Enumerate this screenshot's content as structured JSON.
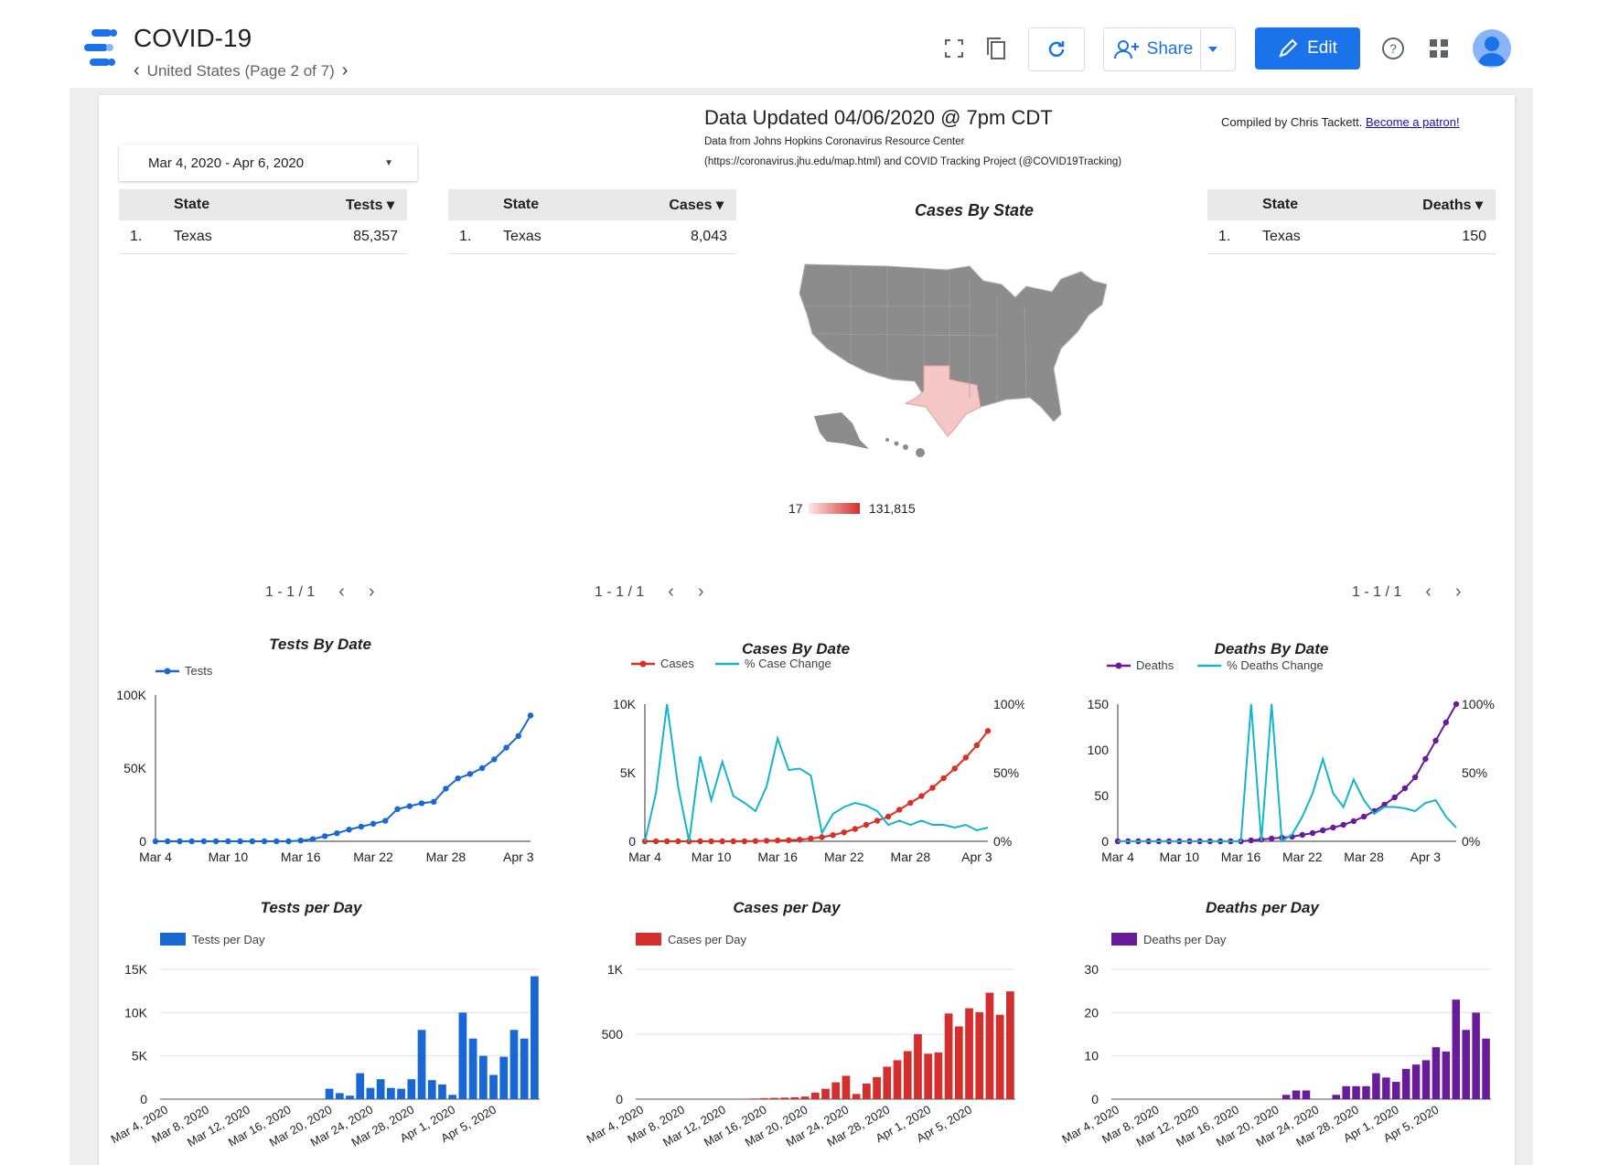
{
  "header": {
    "app_title": "COVID-19",
    "page_nav": "United States (Page 2 of 7)",
    "share_label": "Share",
    "edit_label": "Edit",
    "icons": [
      "fullscreen-icon",
      "copy-icon",
      "refresh-icon",
      "help-icon",
      "apps-icon"
    ]
  },
  "report": {
    "date_range": "Mar 4, 2020 - Apr 6, 2020",
    "title": "Data Updated 04/06/2020 @ 7pm CDT",
    "source_line1": "Data from Johns Hopkins Coronavirus Resource Center",
    "source_line2": "(https://coronavirus.jhu.edu/map.html) and COVID Tracking Project (@COVID19Tracking)",
    "credit_text": "Compiled by Chris Tackett.",
    "credit_link": "Become a patron!"
  },
  "tables": {
    "tests": {
      "col1": "State",
      "col2": "Tests ▾",
      "rank": "1.",
      "state": "Texas",
      "value": "85,357",
      "pager": "1 - 1 / 1"
    },
    "cases": {
      "col1": "State",
      "col2": "Cases ▾",
      "rank": "1.",
      "state": "Texas",
      "value": "8,043",
      "pager": "1 - 1 / 1"
    },
    "deaths": {
      "col1": "State",
      "col2": "Deaths ▾",
      "rank": "1.",
      "state": "Texas",
      "value": "150",
      "pager": "1 - 1 / 1"
    }
  },
  "map": {
    "title": "Cases By State",
    "legend_min": "17",
    "legend_max": "131,815",
    "highlight_color": "#f4c7c6",
    "base_color": "#8c8c8c"
  },
  "chart_data": [
    {
      "type": "line",
      "title": "Tests By Date",
      "x_ticks": [
        "Mar 4",
        "Mar 10",
        "Mar 16",
        "Mar 22",
        "Mar 28",
        "Apr 3"
      ],
      "y_ticks": [
        "0",
        "50K",
        "100K"
      ],
      "ylim": [
        0,
        100000
      ],
      "series": [
        {
          "name": "Tests",
          "color": "#1967d2",
          "values": [
            0,
            0,
            0,
            0,
            0,
            0,
            0,
            0,
            0,
            0,
            0,
            0,
            500,
            1500,
            3500,
            5500,
            8000,
            10000,
            12000,
            14000,
            22000,
            24000,
            26000,
            27000,
            36000,
            43000,
            46000,
            50000,
            56000,
            64000,
            72000,
            86000
          ]
        }
      ]
    },
    {
      "type": "line",
      "title": "Cases By Date",
      "x_ticks": [
        "Mar 4",
        "Mar 10",
        "Mar 16",
        "Mar 22",
        "Mar 28",
        "Apr 3"
      ],
      "y_ticks": [
        "0",
        "5K",
        "10K"
      ],
      "y2_ticks": [
        "0%",
        "50%",
        "100%"
      ],
      "ylim": [
        0,
        10000
      ],
      "series": [
        {
          "name": "Cases",
          "color": "#d93025",
          "values": [
            0,
            0,
            0,
            0,
            0,
            0,
            0,
            0,
            0,
            0,
            20,
            40,
            60,
            80,
            120,
            200,
            300,
            450,
            650,
            900,
            1200,
            1500,
            1800,
            2300,
            2800,
            3300,
            3900,
            4600,
            5300,
            6100,
            7000,
            8043
          ]
        },
        {
          "name": "% Case Change",
          "color": "#12b5cb",
          "axis": "right",
          "values": [
            0,
            35,
            100,
            40,
            0,
            62,
            30,
            58,
            33,
            28,
            22,
            40,
            75,
            52,
            53,
            48,
            6,
            20,
            25,
            28,
            26,
            22,
            12,
            15,
            12,
            15,
            12,
            12,
            10,
            12,
            8,
            10
          ]
        }
      ]
    },
    {
      "type": "line",
      "title": "Deaths By Date",
      "x_ticks": [
        "Mar 4",
        "Mar 10",
        "Mar 16",
        "Mar 22",
        "Mar 28",
        "Apr 3"
      ],
      "y_ticks": [
        "0",
        "50",
        "100",
        "150"
      ],
      "y2_ticks": [
        "0%",
        "50%",
        "100%"
      ],
      "ylim": [
        0,
        150
      ],
      "series": [
        {
          "name": "Deaths",
          "color": "#6a1b9a",
          "values": [
            0,
            0,
            0,
            0,
            0,
            0,
            0,
            0,
            0,
            0,
            0,
            0,
            0,
            1,
            2,
            3,
            4,
            5,
            7,
            9,
            12,
            15,
            18,
            22,
            27,
            33,
            40,
            48,
            58,
            70,
            90,
            110,
            130,
            150
          ]
        },
        {
          "name": "% Deaths Change",
          "color": "#12b5cb",
          "axis": "right",
          "values": [
            0,
            0,
            0,
            0,
            0,
            0,
            0,
            0,
            0,
            0,
            0,
            0,
            0,
            100,
            0,
            100,
            0,
            5,
            18,
            35,
            60,
            35,
            25,
            45,
            30,
            20,
            25,
            25,
            24,
            22,
            28,
            30,
            18,
            10
          ]
        }
      ]
    },
    {
      "type": "bar",
      "title": "Tests per Day",
      "legend": "Tests per Day",
      "color": "#1967d2",
      "y_ticks": [
        "0",
        "5K",
        "10K",
        "15K"
      ],
      "ylim": [
        0,
        15000
      ],
      "x_ticks": [
        "Mar 4, 2020",
        "Mar 8, 2020",
        "Mar 12, 2020",
        "Mar 16, 2020",
        "Mar 20, 2020",
        "Mar 24, 2020",
        "Mar 28, 2020",
        "Apr 1, 2020",
        "Apr 5, 2020"
      ],
      "values": [
        0,
        0,
        0,
        0,
        0,
        0,
        0,
        0,
        0,
        0,
        0,
        0,
        0,
        0,
        0,
        0,
        1200,
        700,
        400,
        3000,
        1300,
        2300,
        1300,
        1200,
        2300,
        8000,
        2200,
        1700,
        500,
        10000,
        7000,
        5000,
        2800,
        4900,
        8000,
        7000,
        14200
      ]
    },
    {
      "type": "bar",
      "title": "Cases per Day",
      "legend": "Cases per Day",
      "color": "#d32f2f",
      "y_ticks": [
        "0",
        "500",
        "1K"
      ],
      "ylim": [
        0,
        1000
      ],
      "x_ticks": [
        "Mar 4, 2020",
        "Mar 8, 2020",
        "Mar 12, 2020",
        "Mar 16, 2020",
        "Mar 20, 2020",
        "Mar 24, 2020",
        "Mar 28, 2020",
        "Apr 1, 2020",
        "Apr 5, 2020"
      ],
      "values": [
        0,
        0,
        0,
        0,
        0,
        0,
        0,
        0,
        0,
        0,
        3,
        5,
        8,
        10,
        12,
        15,
        20,
        50,
        80,
        130,
        180,
        40,
        120,
        170,
        250,
        300,
        370,
        500,
        350,
        360,
        660,
        560,
        700,
        670,
        820,
        650,
        830
      ]
    },
    {
      "type": "bar",
      "title": "Deaths per Day",
      "legend": "Deaths per Day",
      "color": "#6a1b9a",
      "y_ticks": [
        "0",
        "10",
        "20",
        "30"
      ],
      "ylim": [
        0,
        30
      ],
      "x_ticks": [
        "Mar 4, 2020",
        "Mar 8, 2020",
        "Mar 12, 2020",
        "Mar 16, 2020",
        "Mar 20, 2020",
        "Mar 24, 2020",
        "Mar 28, 2020",
        "Apr 1, 2020",
        "Apr 5, 2020"
      ],
      "values": [
        0,
        0,
        0,
        0,
        0,
        0,
        0,
        0,
        0,
        0,
        0,
        0,
        0,
        0,
        0,
        0,
        0,
        1,
        2,
        2,
        0,
        0,
        1,
        3,
        3,
        3,
        6,
        5,
        4,
        7,
        8,
        9,
        12,
        11,
        23,
        16,
        20,
        14
      ]
    }
  ]
}
